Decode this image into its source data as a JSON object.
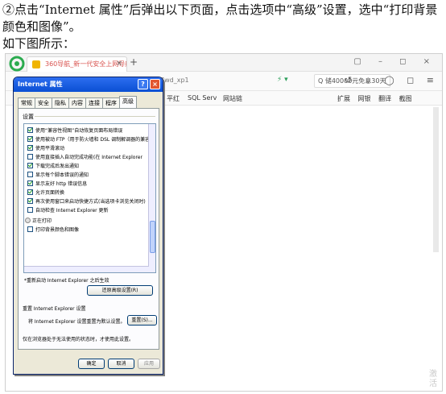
{
  "instruction": {
    "line1": "②点击“Internet 属性”后弹出以下页面，点击选项中“高级”设置，选中“打印背景颜色和图像”。",
    "line2": "如下图所示："
  },
  "browser": {
    "tab_title": "360导航_新一代安全上网导航",
    "tab_close": "×",
    "new_tab": "+",
    "window_controls": "▢ – ◻ ×",
    "address_tail": "7wd_xp1",
    "search_text": "Q 储40000元免息30天",
    "nav_icons": "↺ ⌄ ◯ ◻ ≡",
    "address_icons": "⚡ ▾",
    "favorites": {
      "item1": "平红",
      "item2": "SQL Serv",
      "item3": "网站链",
      "right": [
        "扩展",
        "网银",
        "翻译",
        "截图"
      ]
    },
    "watermark": "激活"
  },
  "dialog": {
    "title": "Internet 属性",
    "help": "?",
    "close": "×",
    "tabs": [
      "常规",
      "安全",
      "隐私",
      "内容",
      "连接",
      "程序",
      "高级"
    ],
    "group_label": "设置",
    "options": [
      {
        "label": "使用“兼容性视图”自动恢复页面布局错误",
        "checked": true
      },
      {
        "label": "使用被动 FTP（用于防火墙和 DSL 调制解调器的兼容",
        "checked": true
      },
      {
        "label": "使用平滑滚动",
        "checked": true
      },
      {
        "label": "使用直接插入自动完成功能(在 Internet Explorer",
        "checked": false
      },
      {
        "label": "下载完成后发出通知",
        "checked": true
      },
      {
        "label": "显示每个脚本错误的通知",
        "checked": false
      },
      {
        "label": "显示友好 http 错误信息",
        "checked": true
      },
      {
        "label": "允许页面转换",
        "checked": true
      },
      {
        "label": "再次使用窗口来启动快捷方式(当选项卡浏览关闭时)",
        "checked": true
      },
      {
        "label": "自动检查 Internet Explorer 更新",
        "checked": false
      }
    ],
    "print_group": "正在打印",
    "print_option": "打印背景颜色和图像",
    "restart_note": "*重新启动 Internet Explorer 之后生效",
    "restore_advanced": "还原高级设置(R)",
    "reset_title": "重置 Internet Explorer 设置",
    "reset_desc": "将 Internet Explorer 设置重置为默认设置。",
    "reset_button": "重置(S)...",
    "foot_note": "仅在浏览器处于无法使用的状态时，才使用此设置。",
    "ok": "确定",
    "cancel": "取消",
    "apply": "应用"
  }
}
